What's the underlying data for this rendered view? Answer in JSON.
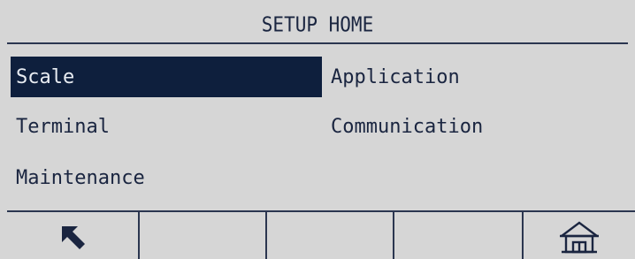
{
  "screen": {
    "title": "SETUP HOME"
  },
  "menu": {
    "items": [
      {
        "label": "Scale",
        "selected": true
      },
      {
        "label": "Application",
        "selected": false
      },
      {
        "label": "Terminal",
        "selected": false
      },
      {
        "label": "Communication",
        "selected": false
      },
      {
        "label": "Maintenance",
        "selected": false
      }
    ]
  },
  "softkeys": [
    {
      "icon": "back-arrow-icon"
    },
    {
      "icon": ""
    },
    {
      "icon": ""
    },
    {
      "icon": ""
    },
    {
      "icon": "home-icon"
    }
  ],
  "colors": {
    "background": "#d6d6d6",
    "foreground": "#1a2540",
    "selection": "#0e1f3d",
    "selection_text": "#e8ecf2"
  }
}
